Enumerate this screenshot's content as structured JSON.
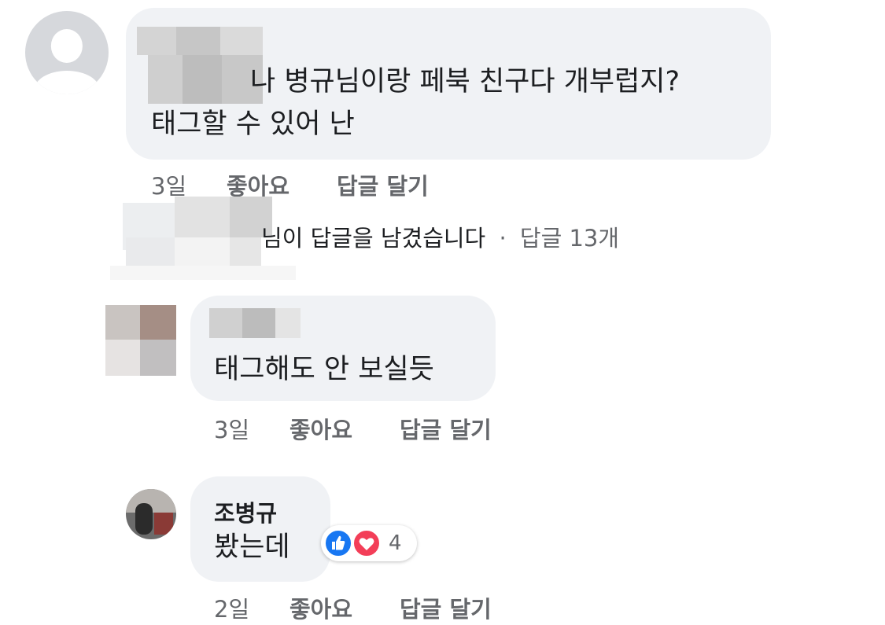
{
  "comments": [
    {
      "text_line1": "나 병규님이랑 페북 친구다 개부럽지?",
      "text_line2": "태그할 수 있어 난",
      "meta": {
        "time": "3일",
        "like": "좋아요",
        "reply": "답글 달기"
      }
    },
    {
      "text": "태그해도 안 보실듯",
      "meta": {
        "time": "3일",
        "like": "좋아요",
        "reply": "답글 달기"
      }
    },
    {
      "author": "조병규",
      "text": "봤는데",
      "reactions": {
        "count": "4",
        "icons": [
          "like-icon",
          "love-icon"
        ]
      },
      "meta": {
        "time": "2일",
        "like": "좋아요",
        "reply": "답글 달기"
      }
    }
  ],
  "reply_summary": {
    "text": "님이 답글을 남겼습니다",
    "separator": "·",
    "count_link": "답글 13개"
  },
  "colors": {
    "bubble": "#f0f2f5",
    "meta_text": "#65676b",
    "like_blue": "#1877f2",
    "love_red": "#f33e58"
  }
}
